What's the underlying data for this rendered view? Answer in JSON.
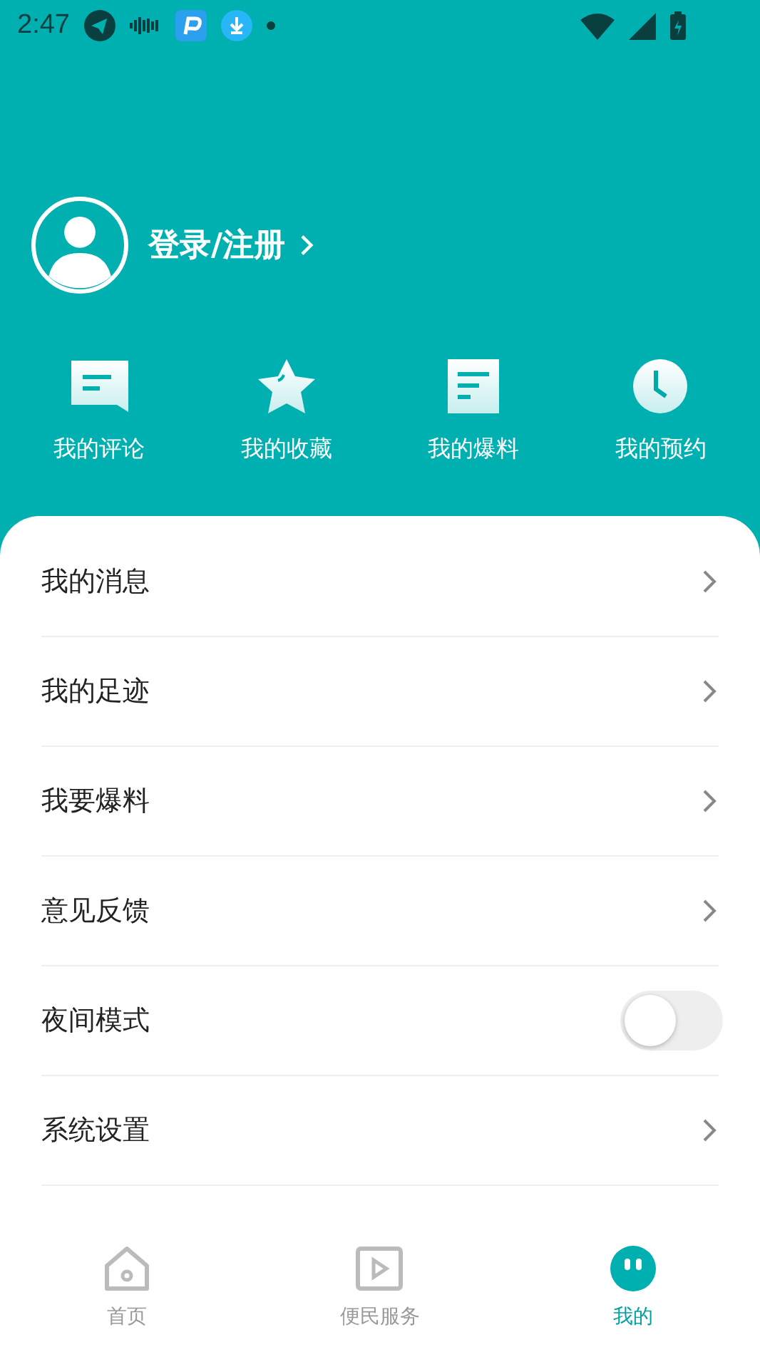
{
  "status_bar": {
    "time": "2:47"
  },
  "profile": {
    "login_label": "登录/注册"
  },
  "shortcuts": [
    {
      "label": "我的评论",
      "kind": "comment"
    },
    {
      "label": "我的收藏",
      "kind": "star"
    },
    {
      "label": "我的爆料",
      "kind": "document"
    },
    {
      "label": "我的预约",
      "kind": "clock"
    }
  ],
  "menu": [
    {
      "label": "我的消息",
      "kind": "link"
    },
    {
      "label": "我的足迹",
      "kind": "link"
    },
    {
      "label": "我要爆料",
      "kind": "link"
    },
    {
      "label": "意见反馈",
      "kind": "link"
    },
    {
      "label": "夜间模式",
      "kind": "toggle",
      "on": false
    },
    {
      "label": "系统设置",
      "kind": "link"
    }
  ],
  "bottom_nav": [
    {
      "label": "首页",
      "kind": "home",
      "selected": false
    },
    {
      "label": "便民服务",
      "kind": "play",
      "selected": false
    },
    {
      "label": "我的",
      "kind": "face",
      "selected": true
    }
  ]
}
